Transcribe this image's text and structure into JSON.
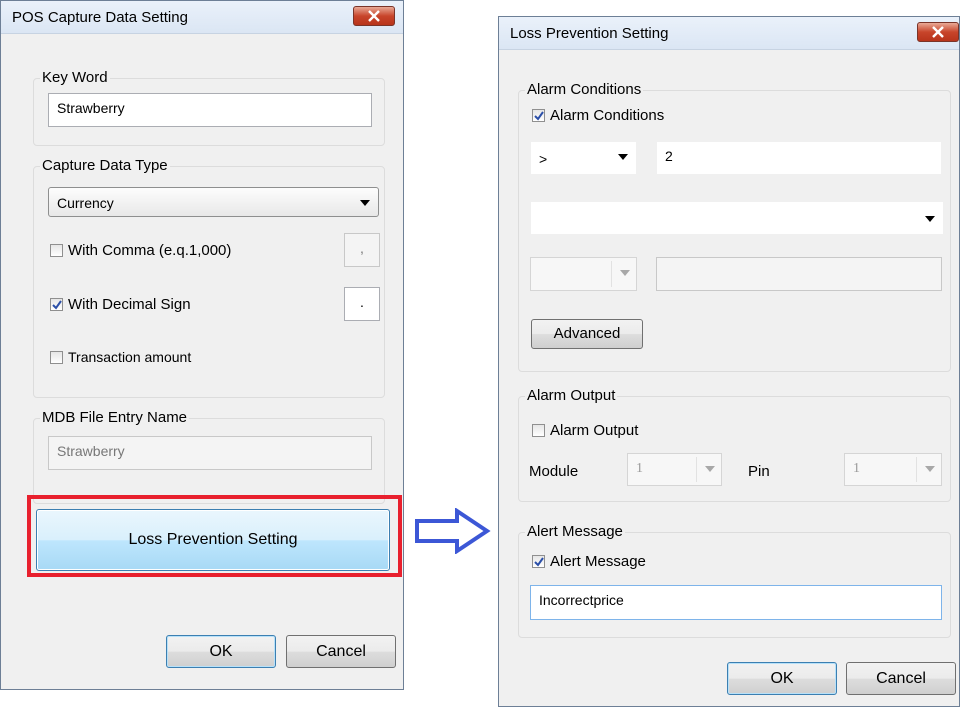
{
  "pos_dialog": {
    "title": "POS Capture Data Setting",
    "key_word": {
      "legend": "Key Word",
      "value": "Strawberry"
    },
    "capture_type": {
      "legend": "Capture Data Type",
      "selected": "Currency",
      "with_comma": {
        "label": "With Comma (e.q.1,000)",
        "checked": false,
        "sep_value": ","
      },
      "with_decimal": {
        "label": "With Decimal Sign",
        "checked": true,
        "sep_value": "."
      },
      "transaction_amount": {
        "label": "Transaction amount",
        "checked": false
      }
    },
    "mdb": {
      "legend": "MDB File Entry Name",
      "value": "Strawberry"
    },
    "loss_button_label": "Loss Prevention Setting",
    "ok_label": "OK",
    "cancel_label": "Cancel"
  },
  "loss_dialog": {
    "title": "Loss Prevention Setting",
    "alarm_conditions": {
      "legend": "Alarm Conditions",
      "checkbox_label": "Alarm Conditions",
      "checked": true,
      "operator": ">",
      "value": "2",
      "field_select": "",
      "secondary_operator": "",
      "secondary_value": "",
      "advanced_label": "Advanced"
    },
    "alarm_output": {
      "legend": "Alarm Output",
      "checkbox_label": "Alarm Output",
      "checked": false,
      "module_label": "Module",
      "module_value": "1",
      "pin_label": "Pin",
      "pin_value": "1"
    },
    "alert_message": {
      "legend": "Alert Message",
      "checkbox_label": "Alert Message",
      "checked": true,
      "value": "Incorrectprice"
    },
    "ok_label": "OK",
    "cancel_label": "Cancel"
  },
  "colors": {
    "highlight": "#e8202e",
    "arrow": "#3c57d6"
  }
}
